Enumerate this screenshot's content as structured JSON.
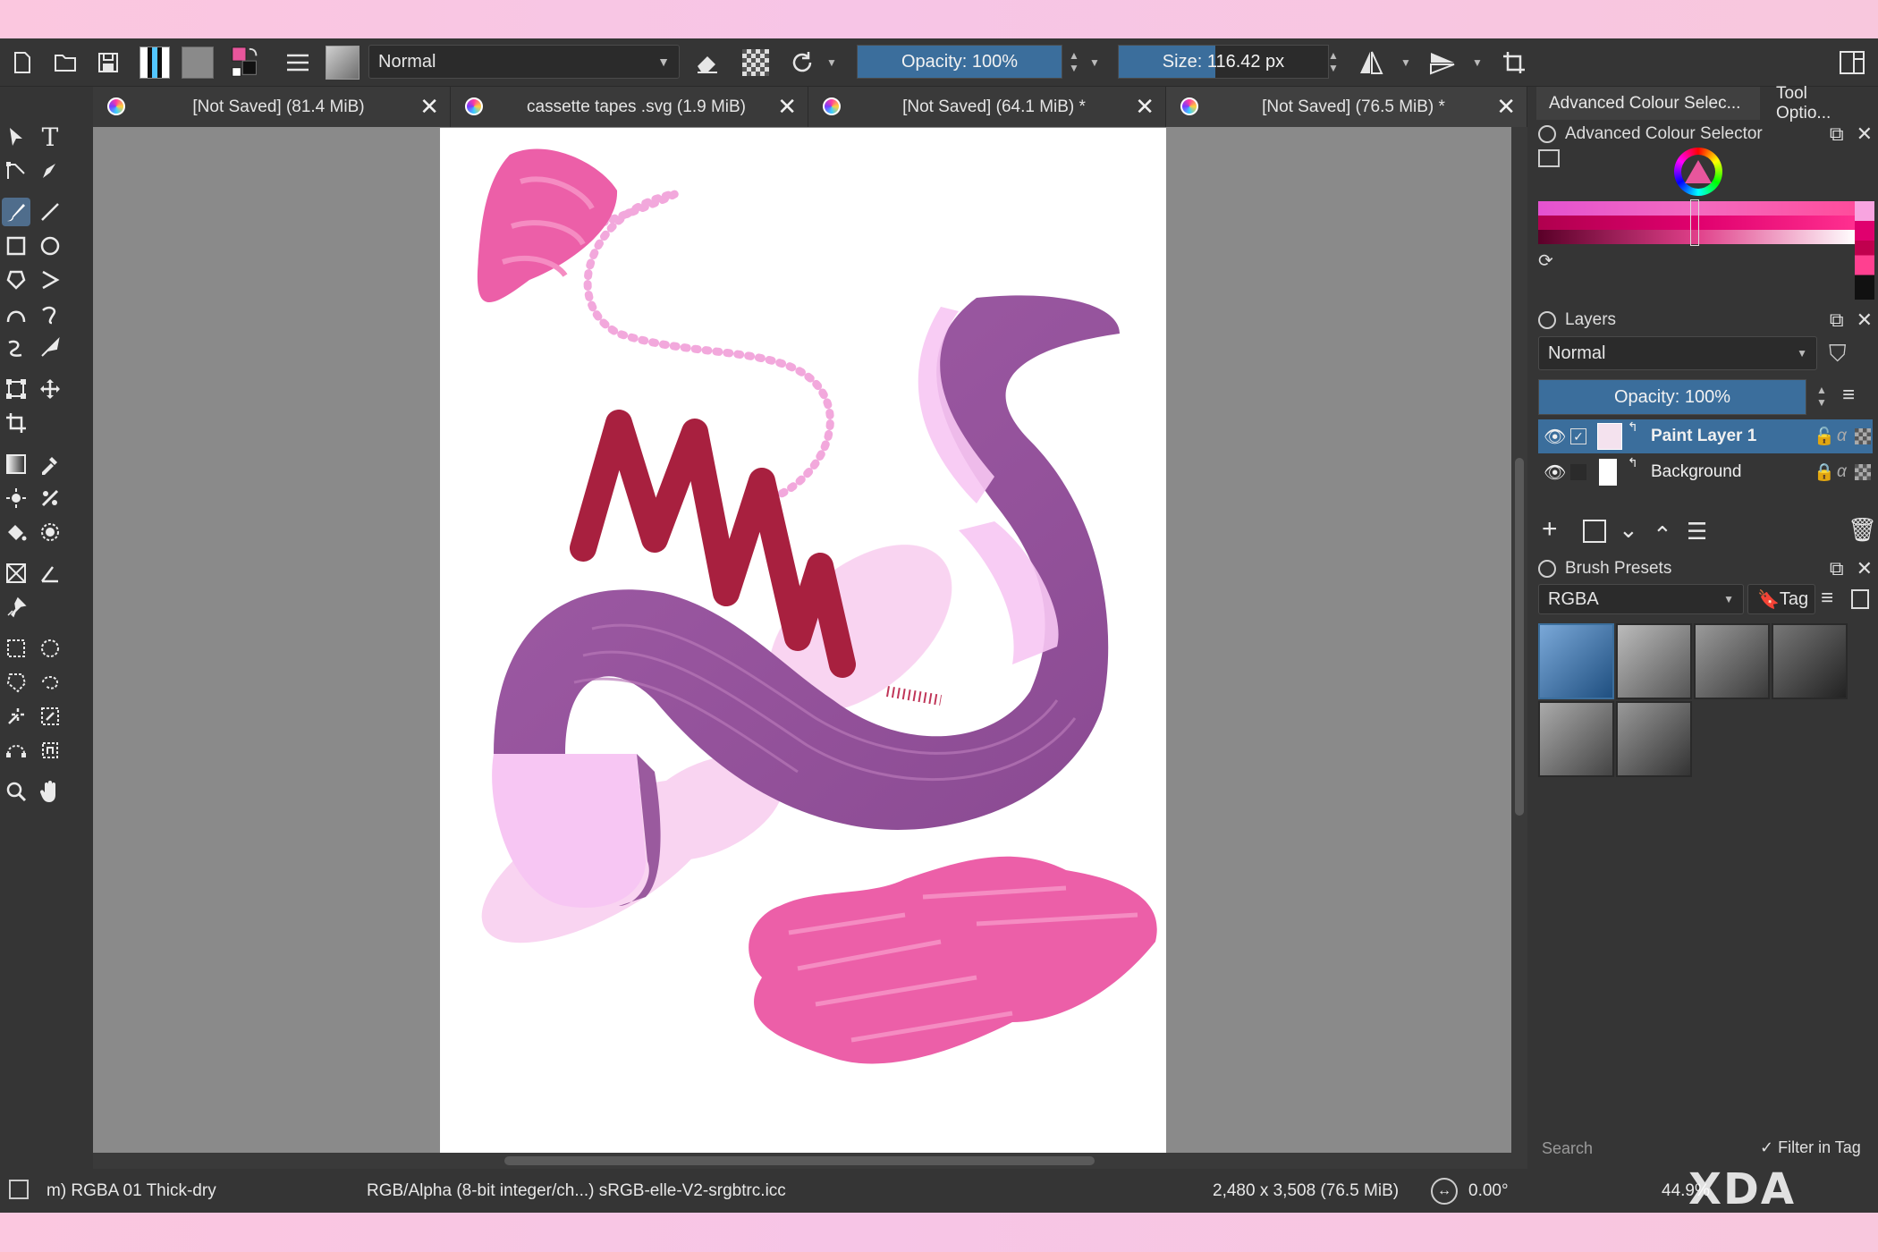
{
  "toolbar": {
    "blend_mode": "Normal",
    "opacity": "Opacity: 100%",
    "size": "Size: 116.42 px",
    "opacity_fraction": 1.0,
    "size_fraction": 0.46
  },
  "tabs": [
    {
      "label": "[Not Saved]  (81.4 MiB)"
    },
    {
      "label": "cassette tapes .svg (1.9 MiB)"
    },
    {
      "label": "[Not Saved]  (64.1 MiB) *"
    },
    {
      "label": "[Not Saved]  (76.5 MiB) *"
    }
  ],
  "dock": {
    "tab_colour": "Advanced Colour Selec...",
    "tab_tool": "Tool Optio...",
    "colour_panel_title": "Advanced Colour Selector",
    "layers_title": "Layers",
    "layers_blend": "Normal",
    "layers_opacity": "Opacity:  100%",
    "layers": [
      {
        "name": "Paint Layer 1",
        "selected": true
      },
      {
        "name": "Background",
        "selected": false
      }
    ],
    "presets_title": "Brush Presets",
    "presets_filter": "RGBA",
    "tag_label": "Tag",
    "search_placeholder": "Search",
    "filter_in_tag": "Filter in Tag"
  },
  "status": {
    "brush": "m) RGBA 01 Thick-dry",
    "color_space": "RGB/Alpha (8-bit integer/ch...)  sRGB-elle-V2-srgbtrc.icc",
    "dimensions": "2,480 x 3,508 (76.5 MiB)",
    "rotation": "0.00°",
    "zoom": "44.9%"
  },
  "watermark": "XDA",
  "colors": {
    "accent": "#3b6e9c",
    "fg_color": "#e8569c",
    "pink": "#ec5fa8",
    "purple": "#9a5a9e",
    "crimson": "#a8203f",
    "light_pink": "#f7c6ec"
  }
}
